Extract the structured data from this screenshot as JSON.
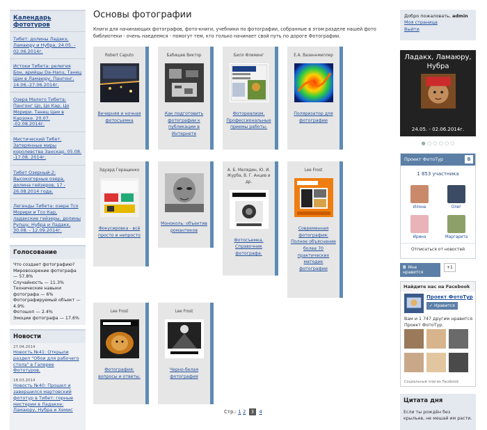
{
  "left": {
    "calendar_title": "Календарь фототуров",
    "calendar_items": [
      "Тибет: долины Ладакх, Ламаюру и Нубра, 24.05. - 02.06.2014г.",
      "Истоки Тибета: религия Бон, арийцы Da-Hanu, Танец Цам в Ламаюру, Пангонг, 14.06.-27.06.2014г.",
      "Озера Малого Тибета: Пангонг Цо, Цо Кар, Цо Морири. Танец Цам в Карзоке. 20.07. -02.08.2014г.",
      "Мистический Тибет. Затерянные миры королевства Занскар, 05.08. -17.08. 2014г.",
      "Тибет Озерный-2: Высокогорные озера, долина гейзеров, 17 - 26.08.2014 года.",
      "Легенды Тибета: озера Тсо Морири и Тсо Кар, ладакские гейзеры, долины Рупшу, Нубра и Ладакх, 30.08. - 12.09.2014г."
    ],
    "vote_title": "Голосование",
    "vote_lines": [
      "Что создает фотографию?",
      "Мировоззрение фотографа — 57.8%",
      "Случайность — 11.3%",
      "Технические навыки фотографа — 6%",
      "Фотографируемый объект — 4.9%",
      "Фотошоп — 2.4%",
      "Эмоции фотографа — 17.6%"
    ],
    "news_title": "Новости",
    "news": [
      {
        "date": "27.04.2014",
        "text": "Новость №41: Открыли раздел \"Обои для рабочего стола\" в Галерее Фототуров."
      },
      {
        "date": "18.03.2014",
        "text": "Новость №40: Прошел и завершился мартовский фототур в Тибет: горные мистерии в Ладакхе: Ламаюру, Нубра и Хемис"
      }
    ]
  },
  "main": {
    "title": "Основы фотографии",
    "intro": "Книги для начинающих фотографов, фото-книги, учебники по фотографии, собранные в этом разделе нашей фото библиотеки - очень наедеемся - помогут тем, кто только начинает свой путь по дороге Фотографии.",
    "books": [
      {
        "author": "Robert Caputo",
        "title": "Вечерняя и ночная фотосъемка"
      },
      {
        "author": "Бабищев Виктор",
        "title": "Как подготовить фотографии к публикации в Интернете"
      },
      {
        "author": "Билл Флеминг",
        "title": "Фотореализм. Профессиональные приемы работы."
      },
      {
        "author": "Е.А. Вазеннмиллер",
        "title": "Поляризатор для фотографии"
      },
      {
        "author": "Эдуард Геращенко",
        "title": "Фокусировка - всё просто и непросто"
      },
      {
        "author": "",
        "title": "Моноколь: объектив романтиков"
      },
      {
        "author": "А. Б. Мелядин, Ю. И. Журба, В. Г. Анцев и др.",
        "title": "Фотосъемка. Справочник фотографа."
      },
      {
        "author": "Lee Frost",
        "title": "Современная фотография: Полное объяснение более 70 практических методик фотографии"
      },
      {
        "author": "Lee Frost",
        "title": "Фотография: вопросы и ответы."
      },
      {
        "author": "Lee Frost",
        "title": "Черно-белая фотография"
      }
    ],
    "pager": {
      "label": "Стр.:",
      "p1": "1",
      "p2": "2",
      "current": "3",
      "p4": "4"
    }
  },
  "right": {
    "welcome_prefix": "Добро пожаловать,",
    "welcome_user": "admin",
    "my_page": "Моя страница",
    "logout": "Выйти",
    "slide_title": "Ладакх, Ламаюру, Нубра",
    "slide_date": "24.05. - 02.06.2014г.",
    "vk_title": "Проект ФотоТур",
    "vk_logo": "В",
    "vk_count": "1 853 участника",
    "vk_members": [
      "Илона",
      "Олег",
      "Ирина",
      "Маргарита"
    ],
    "vk_unsub": "Отписаться от новостей",
    "like_label": "Мне нравится",
    "like_count": "+1",
    "fb_head": "Найдите нас на Facebook",
    "fb_name": "Проект ФотоТур",
    "fb_button": "Нравится",
    "fb_text": "Вам и 1 747 другим нравится Проект ФотоТур.",
    "fb_plugin": "Социальный плагин Facebook",
    "quote_title": "Цитата дня",
    "quote_text": "Если ты рождён без крыльев, не мешай им расти."
  }
}
